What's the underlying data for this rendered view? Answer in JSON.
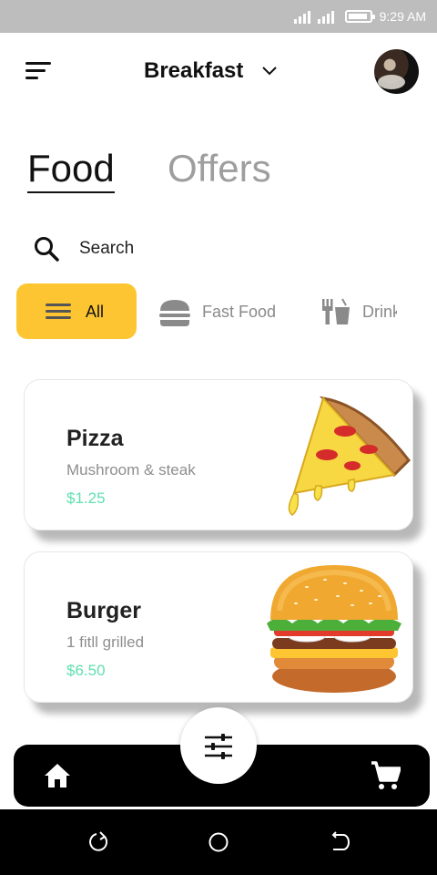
{
  "status_bar": {
    "time": "9:29 AM"
  },
  "header": {
    "title": "Breakfast"
  },
  "tabs": [
    {
      "label": "Food",
      "active": true
    },
    {
      "label": "Offers",
      "active": false
    }
  ],
  "search": {
    "label": "Search"
  },
  "categories": [
    {
      "label": "All",
      "icon": "list-icon",
      "selected": true
    },
    {
      "label": "Fast Food",
      "icon": "burger-icon",
      "selected": false
    },
    {
      "label": "Drink",
      "icon": "drink-icon",
      "selected": false
    }
  ],
  "products": [
    {
      "name": "Pizza",
      "description": "Mushroom & steak",
      "price": "$1.25",
      "image": "pizza-slice"
    },
    {
      "name": "Burger",
      "description": "1 fitll grilled",
      "price": "$6.50",
      "image": "burger"
    }
  ],
  "colors": {
    "accent": "#fcc531",
    "price": "#5fe0b0",
    "nav": "#000000"
  },
  "bottom_nav": {
    "items": [
      "home-icon",
      "filter-icon",
      "cart-icon"
    ]
  }
}
